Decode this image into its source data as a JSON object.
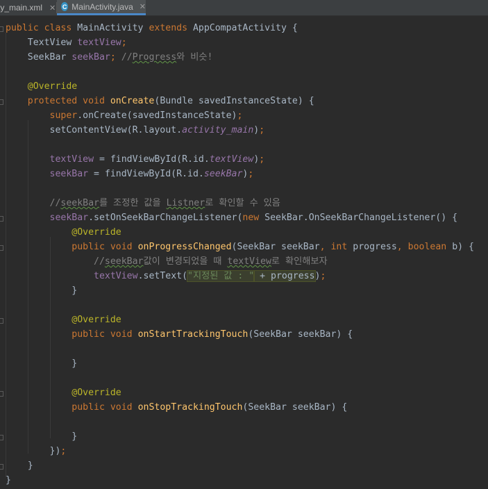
{
  "tabs": [
    {
      "label": "ty_main.xml",
      "icon": "close-icon",
      "active": false
    },
    {
      "label": "MainActivity.java",
      "icon": "java-class-icon",
      "icon_letter": "C",
      "active": true
    }
  ],
  "colors": {
    "background": "#2b2b2b",
    "keyword": "#cc7832",
    "field": "#9876aa",
    "method": "#ffc66d",
    "annotation": "#bbb529",
    "comment": "#808080",
    "string": "#6a8759",
    "default": "#a9b7c6"
  },
  "code": {
    "lines": [
      [
        {
          "t": "public class ",
          "c": "kw"
        },
        {
          "t": "MainActivity "
        },
        {
          "t": "extends ",
          "c": "kw"
        },
        {
          "t": "AppCompatActivity {"
        }
      ],
      [
        {
          "t": "    TextView "
        },
        {
          "t": "textView",
          "c": "fld"
        },
        {
          "t": ";",
          "c": "kw"
        }
      ],
      [
        {
          "t": "    SeekBar "
        },
        {
          "t": "seekBar",
          "c": "fld"
        },
        {
          "t": "; ",
          "c": "kw"
        },
        {
          "t": "//",
          "c": "cm"
        },
        {
          "t": "Progress",
          "c": "cm typo"
        },
        {
          "t": "와 비슷!",
          "c": "cm"
        }
      ],
      [],
      [
        {
          "t": "    @Override",
          "c": "ann"
        }
      ],
      [
        {
          "t": "    protected void ",
          "c": "kw"
        },
        {
          "t": "onCreate",
          "c": "fn"
        },
        {
          "t": "(Bundle savedInstanceState) {"
        }
      ],
      [
        {
          "t": "        super",
          "c": "kw"
        },
        {
          "t": ".onCreate(savedInstanceState)"
        },
        {
          "t": ";",
          "c": "kw"
        }
      ],
      [
        {
          "t": "        setContentView(R.layout."
        },
        {
          "t": "activity_main",
          "c": "fldi"
        },
        {
          "t": ")"
        },
        {
          "t": ";",
          "c": "kw"
        }
      ],
      [],
      [
        {
          "t": "        textView",
          "c": "fld"
        },
        {
          "t": " = findViewById(R.id."
        },
        {
          "t": "textView",
          "c": "fldi"
        },
        {
          "t": ")"
        },
        {
          "t": ";",
          "c": "kw"
        }
      ],
      [
        {
          "t": "        seekBar",
          "c": "fld"
        },
        {
          "t": " = findViewById(R.id."
        },
        {
          "t": "seekBar",
          "c": "fldi"
        },
        {
          "t": ")"
        },
        {
          "t": ";",
          "c": "kw"
        }
      ],
      [],
      [
        {
          "t": "        //",
          "c": "cm"
        },
        {
          "t": "seekBar",
          "c": "cm typo"
        },
        {
          "t": "를 조정한 값을 ",
          "c": "cm"
        },
        {
          "t": "Listner",
          "c": "cm typo"
        },
        {
          "t": "로 확인할 수 있음",
          "c": "cm"
        }
      ],
      [
        {
          "t": "        seekBar",
          "c": "fld"
        },
        {
          "t": ".setOnSeekBarChangeListener("
        },
        {
          "t": "new ",
          "c": "kw"
        },
        {
          "t": "SeekBar.OnSeekBarChangeListener() {"
        }
      ],
      [
        {
          "t": "            @Override",
          "c": "ann"
        }
      ],
      [
        {
          "t": "            public void ",
          "c": "kw"
        },
        {
          "t": "onProgressChanged",
          "c": "fn"
        },
        {
          "t": "(SeekBar seekBar"
        },
        {
          "t": ", ",
          "c": "kw"
        },
        {
          "t": "int ",
          "c": "kw"
        },
        {
          "t": "progress"
        },
        {
          "t": ", ",
          "c": "kw"
        },
        {
          "t": "boolean ",
          "c": "kw"
        },
        {
          "t": "b) {"
        }
      ],
      [
        {
          "t": "                //",
          "c": "cm"
        },
        {
          "t": "seekBar",
          "c": "cm typo"
        },
        {
          "t": "값이 변경되었을 때 ",
          "c": "cm"
        },
        {
          "t": "textView",
          "c": "cm typo"
        },
        {
          "t": "로 확인해보자",
          "c": "cm"
        }
      ],
      [
        {
          "t": "                textView",
          "c": "fld"
        },
        {
          "t": ".setText("
        },
        {
          "t": "\"지정된 값 : \"",
          "c": "str hl"
        },
        {
          "t": " + progress",
          "c": "hl"
        },
        {
          "t": ")"
        },
        {
          "t": ";",
          "c": "kw"
        }
      ],
      [
        {
          "t": "            }"
        }
      ],
      [],
      [
        {
          "t": "            @Override",
          "c": "ann"
        }
      ],
      [
        {
          "t": "            public void ",
          "c": "kw"
        },
        {
          "t": "onStartTrackingTouch",
          "c": "fn"
        },
        {
          "t": "(SeekBar seekBar) {"
        }
      ],
      [],
      [
        {
          "t": "            }"
        }
      ],
      [],
      [
        {
          "t": "            @Override",
          "c": "ann"
        }
      ],
      [
        {
          "t": "            public void ",
          "c": "kw"
        },
        {
          "t": "onStopTrackingTouch",
          "c": "fn"
        },
        {
          "t": "(SeekBar seekBar) {"
        }
      ],
      [],
      [
        {
          "t": "            }"
        }
      ],
      [
        {
          "t": "        })"
        },
        {
          "t": ";",
          "c": "kw"
        }
      ],
      [
        {
          "t": "    }"
        }
      ],
      [
        {
          "t": "}"
        }
      ]
    ]
  }
}
